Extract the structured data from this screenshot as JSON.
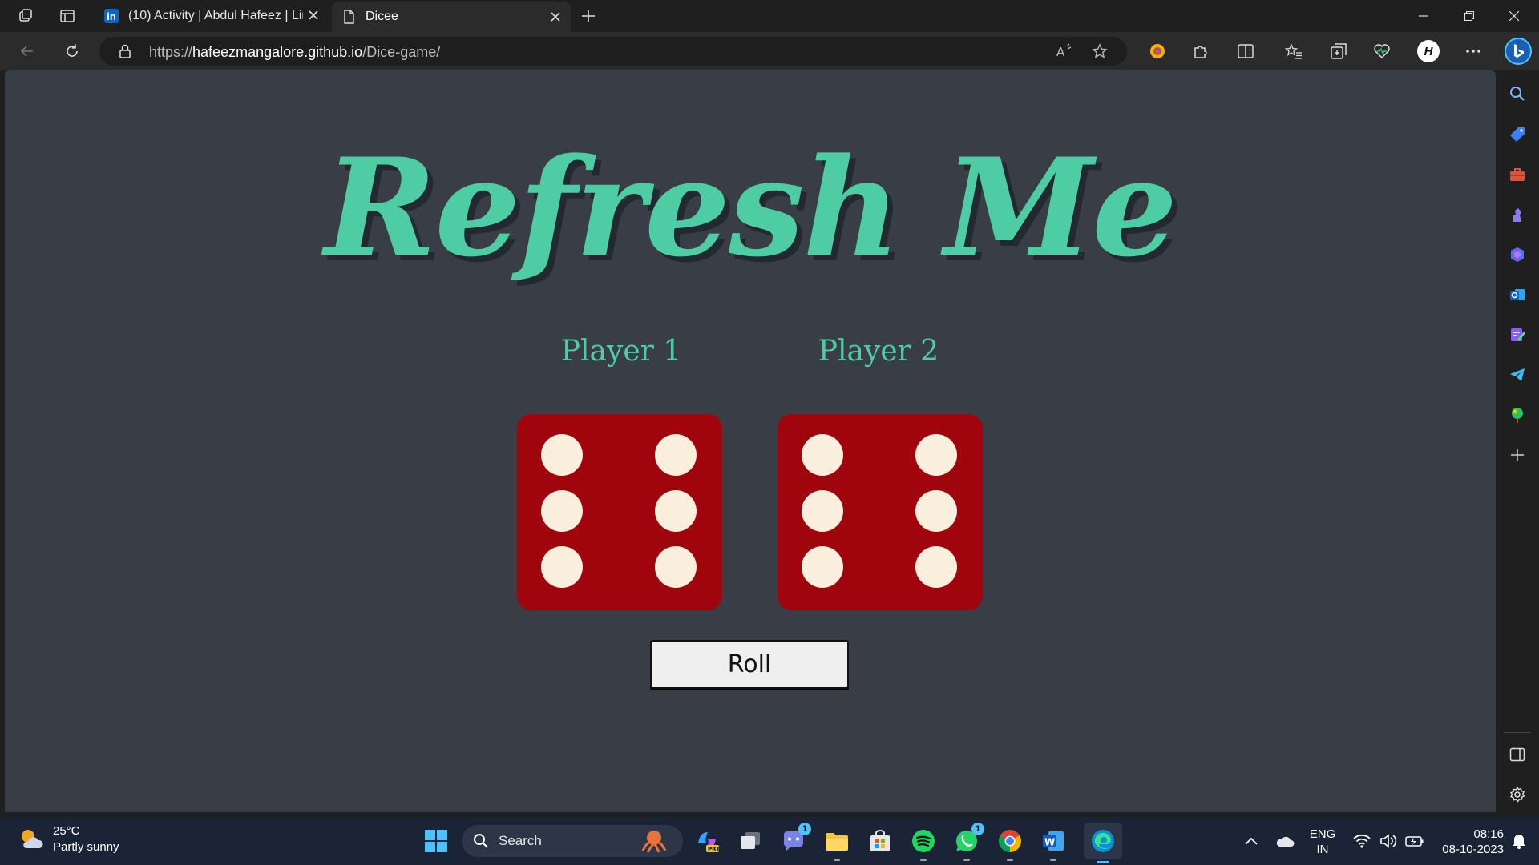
{
  "browser": {
    "tabs": [
      {
        "label": "(10) Activity | Abdul Hafeez | LinkedIn",
        "icon": "linkedin-icon",
        "active": false
      },
      {
        "label": "Dicee",
        "icon": "page-icon",
        "active": true
      }
    ],
    "address": {
      "scheme": "https://",
      "host": "hafeezmangalore.github.io",
      "path": "/Dice-game/"
    },
    "profile_initial": "H"
  },
  "page": {
    "title": "Refresh Me",
    "players": [
      {
        "label": "Player 1",
        "die_value": 6
      },
      {
        "label": "Player 2",
        "die_value": 6
      }
    ],
    "roll_button": "Roll",
    "colors": {
      "background": "#393e46",
      "accent": "#4ecca3",
      "die": "#a0050e",
      "pip": "#faeedc"
    }
  },
  "taskbar": {
    "weather": {
      "temperature": "25°C",
      "condition": "Partly sunny"
    },
    "search_label": "Search",
    "badges": {
      "teams": "1",
      "whatsapp": "1"
    },
    "language": {
      "line1": "ENG",
      "line2": "IN"
    },
    "clock": {
      "time": "08:16",
      "date": "08-10-2023"
    }
  }
}
